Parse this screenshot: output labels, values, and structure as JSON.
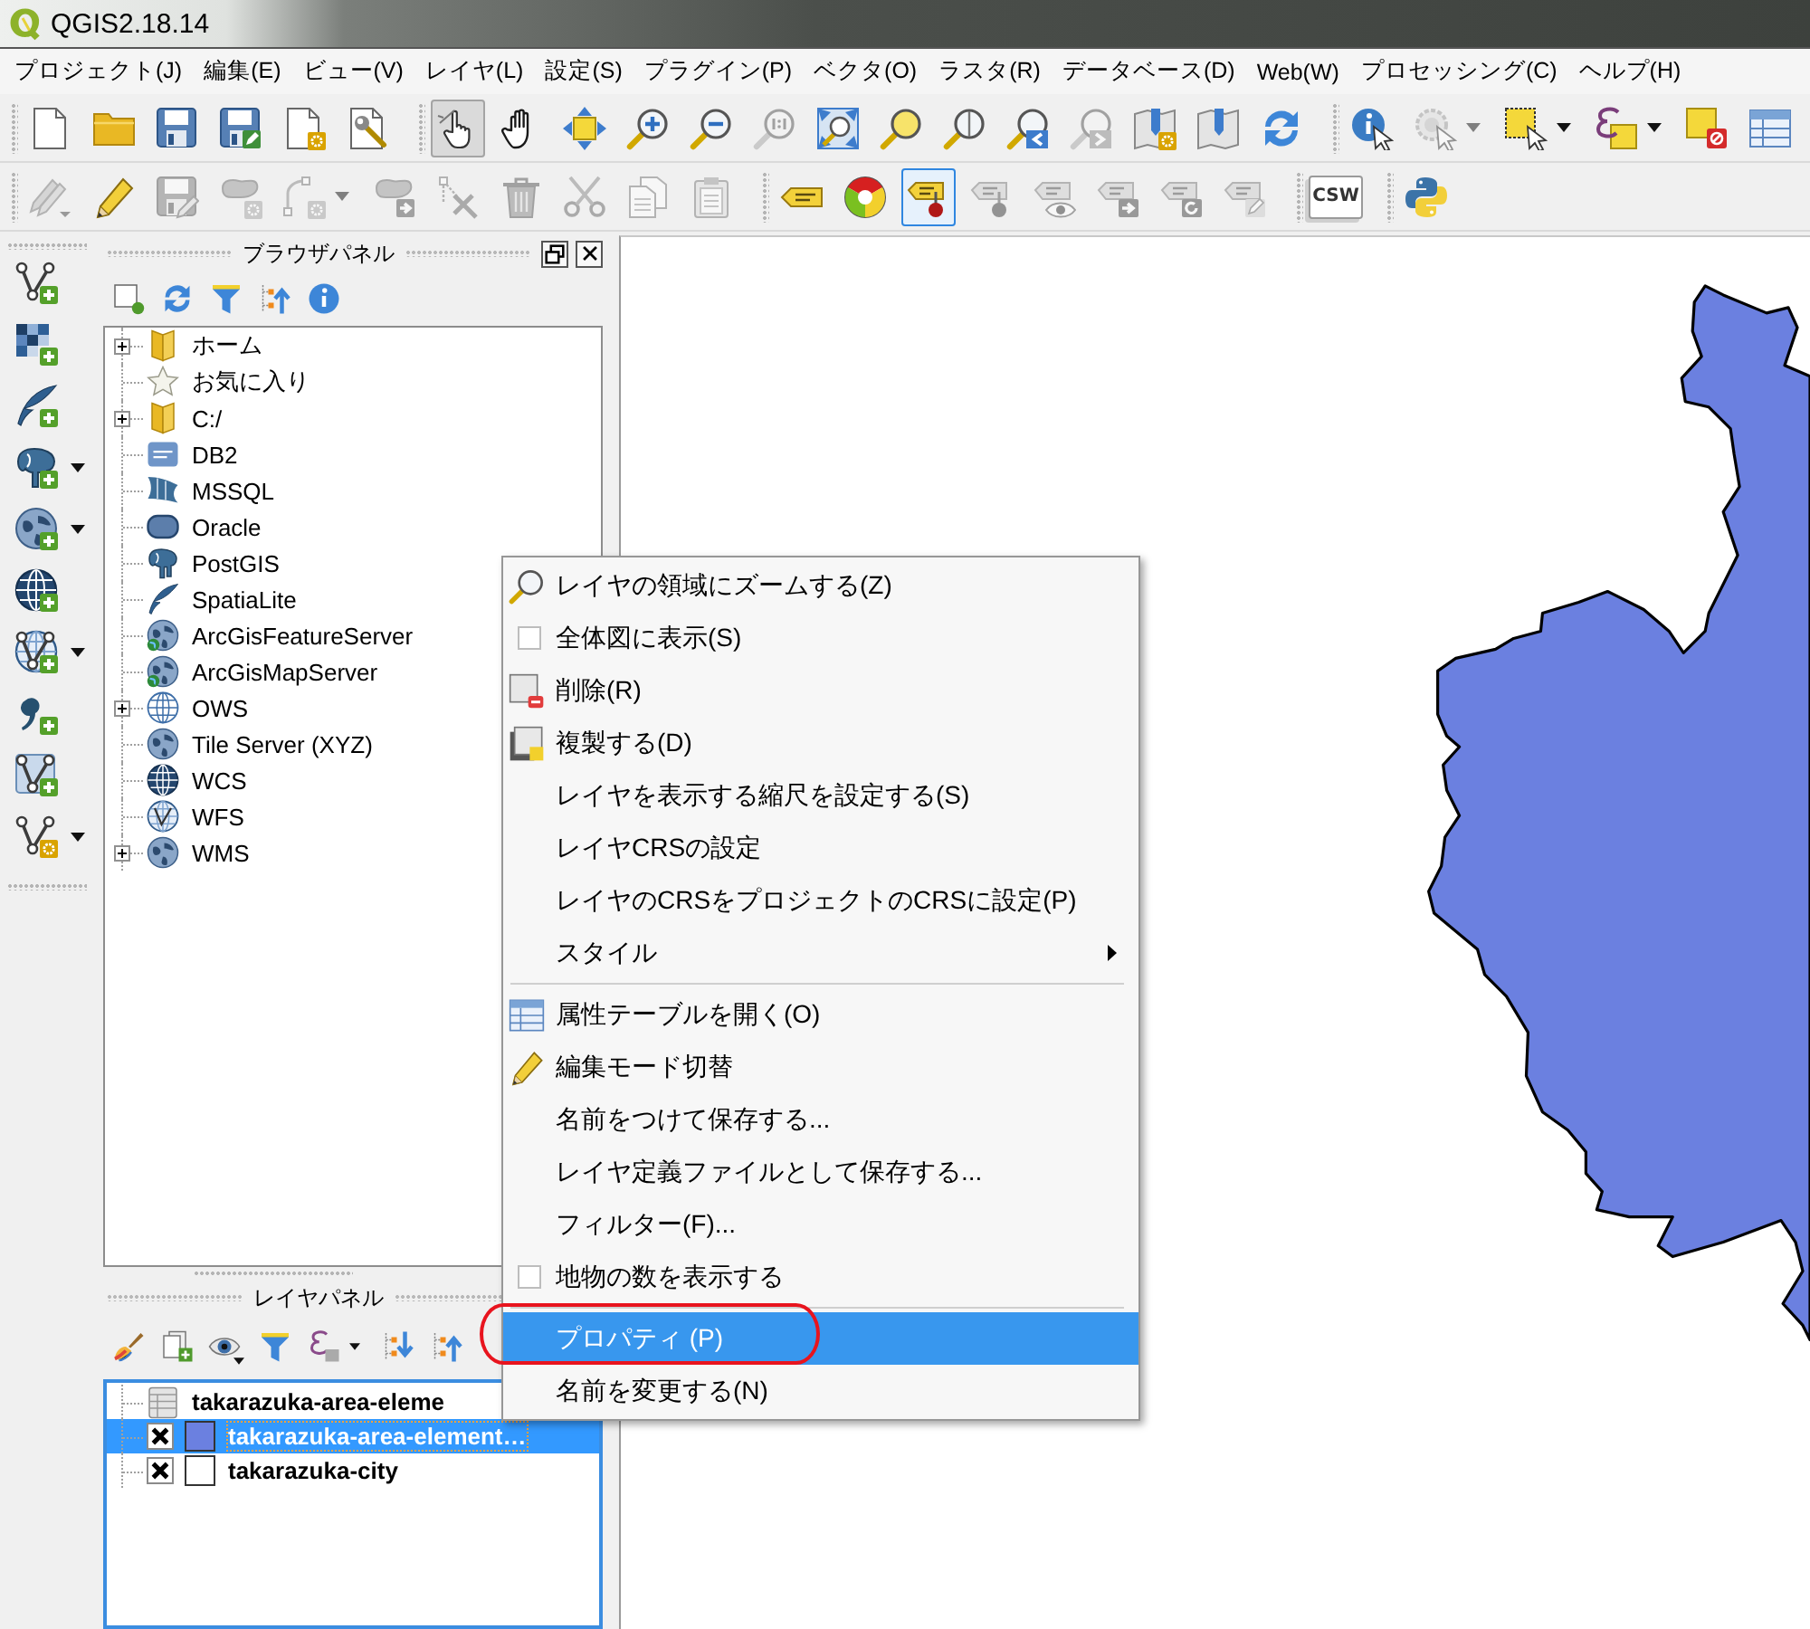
{
  "window": {
    "title": "QGIS2.18.14"
  },
  "menu_bar": [
    "プロジェクト(J)",
    "編集(E)",
    "ビュー(V)",
    "レイヤ(L)",
    "設定(S)",
    "プラグイン(P)",
    "ベクタ(O)",
    "ラスタ(R)",
    "データベース(D)",
    "Web(W)",
    "プロセッシング(C)",
    "ヘルプ(H)"
  ],
  "toolbars": [
    {
      "groups": [
        {
          "buttons": [
            {
              "selected": false,
              "disabled": false,
              "dropdown": false
            },
            {
              "selected": false,
              "disabled": false,
              "dropdown": false
            },
            {
              "selected": false,
              "disabled": false,
              "dropdown": false
            },
            {
              "selected": false,
              "disabled": false,
              "dropdown": false
            },
            {
              "selected": false,
              "disabled": false,
              "dropdown": false
            },
            {
              "selected": false,
              "disabled": false,
              "dropdown": false
            }
          ]
        },
        {
          "buttons": [
            {
              "selected": true,
              "disabled": false,
              "dropdown": false
            },
            {
              "selected": false,
              "disabled": false,
              "dropdown": false
            },
            {
              "selected": false,
              "disabled": false,
              "dropdown": false
            },
            {
              "selected": false,
              "disabled": false,
              "dropdown": false
            },
            {
              "selected": false,
              "disabled": false,
              "dropdown": false
            },
            {
              "selected": false,
              "disabled": true,
              "dropdown": false
            },
            {
              "selected": false,
              "disabled": false,
              "dropdown": false
            },
            {
              "selected": false,
              "disabled": false,
              "dropdown": false
            },
            {
              "selected": false,
              "disabled": false,
              "dropdown": false
            },
            {
              "selected": false,
              "disabled": false,
              "dropdown": false
            },
            {
              "selected": false,
              "disabled": true,
              "dropdown": false
            },
            {
              "selected": false,
              "disabled": false,
              "dropdown": false
            },
            {
              "selected": false,
              "disabled": false,
              "dropdown": false
            },
            {
              "selected": false,
              "disabled": false,
              "dropdown": false
            }
          ]
        },
        {
          "buttons": [
            {
              "selected": false,
              "disabled": false,
              "dropdown": false
            },
            {
              "selected": false,
              "disabled": true,
              "dropdown": true
            },
            {
              "selected": false,
              "disabled": false,
              "dropdown": true
            },
            {
              "selected": false,
              "disabled": false,
              "dropdown": true
            },
            {
              "selected": false,
              "disabled": false,
              "dropdown": false
            },
            {
              "selected": false,
              "disabled": false,
              "dropdown": false
            }
          ]
        }
      ]
    },
    {
      "groups": [
        {
          "buttons": [
            {
              "focused": false,
              "disabled": true,
              "dropdown": false
            },
            {
              "focused": false,
              "disabled": false,
              "dropdown": false
            },
            {
              "focused": false,
              "disabled": true,
              "dropdown": false
            },
            {
              "focused": false,
              "disabled": true,
              "dropdown": false
            },
            {
              "focused": false,
              "disabled": true,
              "dropdown": true
            },
            {
              "focused": false,
              "disabled": true,
              "dropdown": false
            },
            {
              "focused": false,
              "disabled": true,
              "dropdown": false
            },
            {
              "focused": false,
              "disabled": true,
              "dropdown": false
            },
            {
              "focused": false,
              "disabled": true,
              "dropdown": false
            },
            {
              "focused": false,
              "disabled": true,
              "dropdown": false
            },
            {
              "focused": false,
              "disabled": true,
              "dropdown": false
            }
          ]
        },
        {
          "buttons": [
            {
              "focused": false,
              "disabled": false,
              "dropdown": false
            },
            {
              "focused": false,
              "disabled": false,
              "dropdown": false
            },
            {
              "focused": true,
              "disabled": false,
              "dropdown": false
            },
            {
              "focused": false,
              "disabled": true,
              "dropdown": false
            },
            {
              "focused": false,
              "disabled": true,
              "dropdown": false
            },
            {
              "focused": false,
              "disabled": true,
              "dropdown": false
            },
            {
              "focused": false,
              "disabled": true,
              "dropdown": false
            },
            {
              "focused": false,
              "disabled": true,
              "dropdown": false
            }
          ]
        },
        {
          "buttons": [
            {
              "label": "CSW",
              "focused": false,
              "disabled": false,
              "dropdown": false
            }
          ]
        },
        {
          "buttons": [
            {
              "focused": false,
              "disabled": false,
              "dropdown": false
            }
          ]
        }
      ]
    }
  ],
  "side_toolbar": {
    "buttons": [
      {
        "dropdown": false
      },
      {
        "dropdown": false
      },
      {
        "dropdown": false
      },
      {
        "dropdown": true
      },
      {
        "dropdown": true
      },
      {
        "dropdown": false
      },
      {
        "dropdown": true
      },
      {
        "dropdown": false
      },
      {
        "dropdown": false
      },
      {
        "dropdown": true
      }
    ]
  },
  "browser_panel": {
    "title": "ブラウザパネル",
    "toolbar": [
      {
        "dropdown": false
      },
      {
        "dropdown": false
      },
      {
        "dropdown": false
      },
      {
        "dropdown": false
      },
      {
        "dropdown": false
      }
    ],
    "items": [
      {
        "label": "ホーム",
        "expanded": false
      },
      {
        "label": "お気に入り"
      },
      {
        "label": "C:/",
        "expanded": false
      },
      {
        "label": "DB2"
      },
      {
        "label": "MSSQL"
      },
      {
        "label": "Oracle"
      },
      {
        "label": "PostGIS"
      },
      {
        "label": "SpatiaLite"
      },
      {
        "label": "ArcGisFeatureServer"
      },
      {
        "label": "ArcGisMapServer"
      },
      {
        "label": "OWS",
        "expanded": false
      },
      {
        "label": "Tile Server (XYZ)"
      },
      {
        "label": "WCS"
      },
      {
        "label": "WFS"
      },
      {
        "label": "WMS",
        "expanded": false
      }
    ]
  },
  "layers_panel": {
    "title": "レイヤパネル",
    "toolbar": [
      {
        "dropdown": false
      },
      {
        "dropdown": false
      },
      {
        "dropdown": true
      },
      {
        "dropdown": false
      },
      {
        "dropdown": true
      },
      {
        "dropdown": false
      },
      {
        "dropdown": false
      }
    ],
    "layers": [
      {
        "kind": "table",
        "name": "takarazuka-area-eleme",
        "selected": false
      },
      {
        "kind": "vector",
        "name": "takarazuka-area-element…",
        "checked": true,
        "color": "#6b80e0",
        "selected": true
      },
      {
        "kind": "vector",
        "name": "takarazuka-city",
        "checked": true,
        "color": "#ffffff",
        "selected": false
      }
    ]
  },
  "context_menu": {
    "items": [
      {
        "kind": "action",
        "label": "レイヤの領域にズームする(Z)",
        "selected": false,
        "circled": false
      },
      {
        "kind": "checkbox",
        "label": "全体図に表示(S)",
        "checked": false,
        "selected": false,
        "circled": false
      },
      {
        "kind": "action",
        "label": "削除(R)",
        "selected": false,
        "circled": false
      },
      {
        "kind": "action",
        "label": "複製する(D)",
        "selected": false,
        "circled": false
      },
      {
        "kind": "action",
        "label": "レイヤを表示する縮尺を設定する(S)",
        "selected": false,
        "circled": false
      },
      {
        "kind": "action",
        "label": "レイヤCRSの設定",
        "selected": false,
        "circled": false
      },
      {
        "kind": "action",
        "label": "レイヤのCRSをプロジェクトのCRSに設定(P)",
        "selected": false,
        "circled": false
      },
      {
        "kind": "submenu",
        "label": "スタイル",
        "selected": false,
        "circled": false
      },
      {
        "kind": "separator"
      },
      {
        "kind": "action",
        "label": "属性テーブルを開く(O)",
        "selected": false,
        "circled": false
      },
      {
        "kind": "action",
        "label": "編集モード切替",
        "selected": false,
        "circled": false
      },
      {
        "kind": "action",
        "label": "名前をつけて保存する...",
        "selected": false,
        "circled": false
      },
      {
        "kind": "action",
        "label": "レイヤ定義ファイルとして保存する...",
        "selected": false,
        "circled": false
      },
      {
        "kind": "action",
        "label": "フィルター(F)...",
        "selected": false,
        "circled": false
      },
      {
        "kind": "checkbox",
        "label": "地物の数を表示する",
        "checked": false,
        "selected": false,
        "circled": false
      },
      {
        "kind": "separator"
      },
      {
        "kind": "action",
        "label": "プロパティ (P)",
        "selected": true,
        "circled": true
      },
      {
        "kind": "action",
        "label": "名前を変更する(N)",
        "selected": false,
        "circled": false
      }
    ]
  }
}
